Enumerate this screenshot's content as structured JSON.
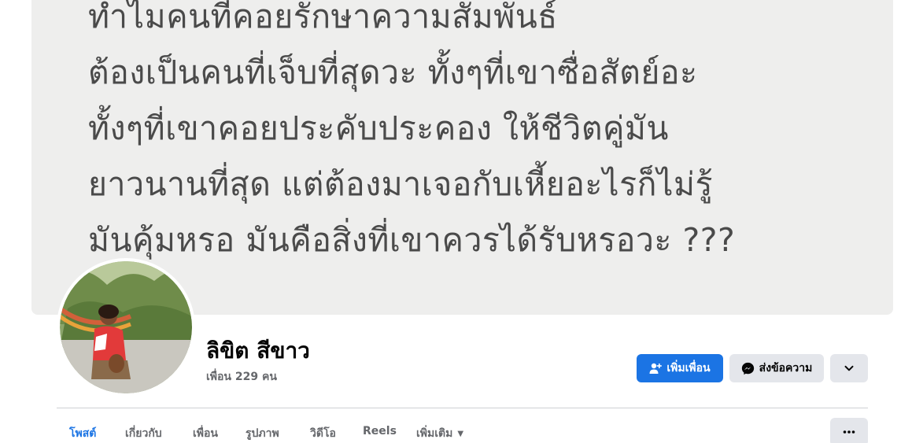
{
  "cover": {
    "lines": [
      "ทำไมคนที่คอยรักษาความสัมพันธ์",
      "ต้องเป็นคนที่เจ็บที่สุดวะ ทั้งๆที่เขาซื่อสัตย์อะ",
      "ทั้งๆที่เขาคอยประคับประคอง ให้ชีวิตคู่มัน",
      "ยาวนานที่สุด แต่ต้องมาเจอกับเหี้ยอะไรก็ไม่รู้",
      "มันคุ้มหรอ มันคือสิ่งที่เขาควรได้รับหรอวะ ???"
    ]
  },
  "profile": {
    "name": "ลิขิต สีขาว",
    "friends": "เพื่อน 229 คน"
  },
  "actions": {
    "add_friend": "เพิ่มเพื่อน",
    "message": "ส่งข้อความ"
  },
  "tabs": [
    {
      "label": "โพสต์",
      "active": true
    },
    {
      "label": "เกี่ยวกับ",
      "active": false
    },
    {
      "label": "เพื่อน",
      "active": false
    },
    {
      "label": "รูปภาพ",
      "active": false
    },
    {
      "label": "วิดีโอ",
      "active": false
    },
    {
      "label": "Reels",
      "active": false
    },
    {
      "label": "เพิ่มเติม",
      "active": false
    }
  ],
  "icons": {
    "add_friend": "add-person-icon",
    "message": "messenger-icon",
    "more": "chevron-down-icon",
    "tabs_more": "ellipsis-icon",
    "tab_more_caret": "caret-down-icon"
  },
  "colors": {
    "accent": "#1b74e4",
    "button_gray": "#e4e6eb",
    "cover_bg": "#eeeeed",
    "text_secondary": "#65676b"
  }
}
